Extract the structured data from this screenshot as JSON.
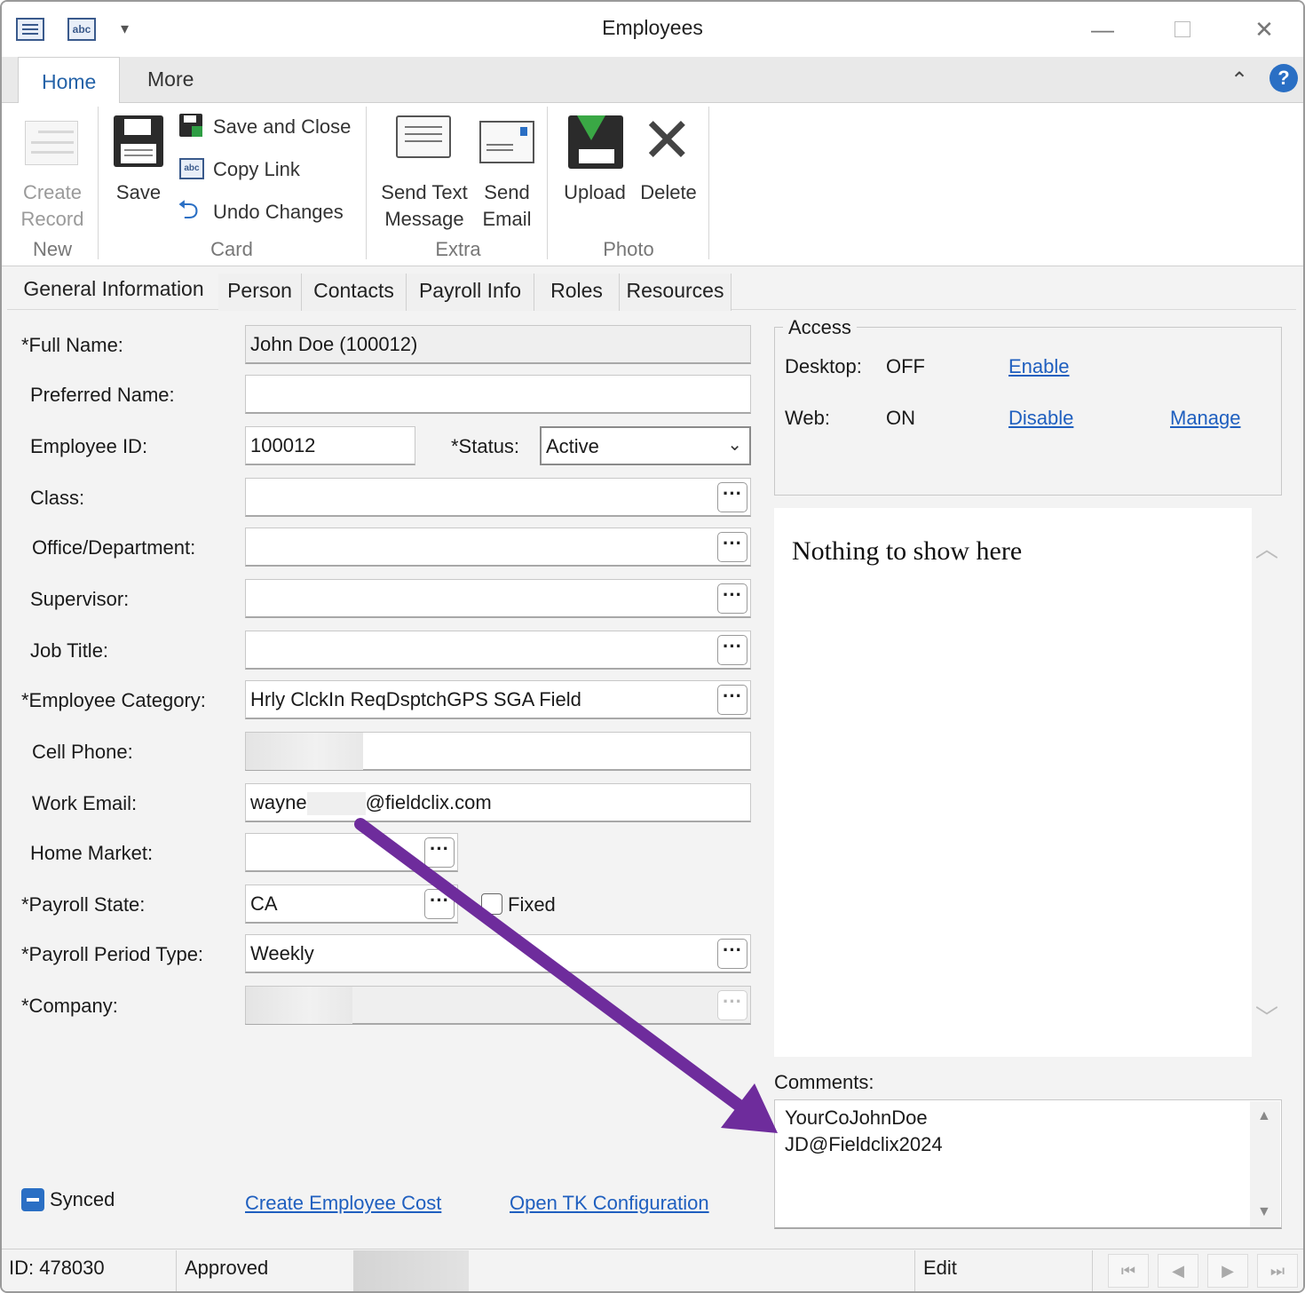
{
  "window": {
    "title": "Employees"
  },
  "ribbon": {
    "tabs": [
      "Home",
      "More"
    ],
    "new_group": {
      "label": "New",
      "create_record": "Create\nRecord"
    },
    "card_group": {
      "label": "Card",
      "save": "Save",
      "save_and_close": "Save and Close",
      "copy_link": "Copy Link",
      "undo_changes": "Undo Changes"
    },
    "extra_group": {
      "label": "Extra",
      "send_text": "Send Text\nMessage",
      "send_email": "Send\nEmail"
    },
    "photo_group": {
      "label": "Photo",
      "upload": "Upload",
      "delete": "Delete"
    }
  },
  "form_tabs": [
    "General Information",
    "Person",
    "Contacts",
    "Payroll Info",
    "Roles",
    "Resources"
  ],
  "form": {
    "full_name": {
      "label": "*Full Name:",
      "value": "John Doe (100012)"
    },
    "preferred_name": {
      "label": "Preferred Name:",
      "value": ""
    },
    "employee_id": {
      "label": "Employee ID:",
      "value": "100012"
    },
    "status": {
      "label": "*Status:",
      "value": "Active"
    },
    "class": {
      "label": "Class:",
      "value": ""
    },
    "office_department": {
      "label": "Office/Department:",
      "value": ""
    },
    "supervisor": {
      "label": "Supervisor:",
      "value": ""
    },
    "job_title": {
      "label": "Job Title:",
      "value": ""
    },
    "employee_category": {
      "label": "*Employee Category:",
      "value": "Hrly ClckIn ReqDsptchGPS SGA Field"
    },
    "cell_phone": {
      "label": "Cell Phone:",
      "value": ""
    },
    "work_email": {
      "label": "Work Email:",
      "value_prefix": "wayne",
      "value_suffix": "@fieldclix.com"
    },
    "home_market": {
      "label": "Home Market:",
      "value": ""
    },
    "payroll_state": {
      "label": "*Payroll State:",
      "value": "CA",
      "fixed_label": "Fixed",
      "fixed_checked": false
    },
    "payroll_period_type": {
      "label": "*Payroll Period Type:",
      "value": "Weekly"
    },
    "company": {
      "label": "*Company:",
      "value": ""
    }
  },
  "access": {
    "title": "Access",
    "desktop": {
      "label": "Desktop:",
      "state": "OFF",
      "action": "Enable"
    },
    "web": {
      "label": "Web:",
      "state": "ON",
      "action": "Disable",
      "manage": "Manage"
    }
  },
  "photo_panel": {
    "empty_text": "Nothing to show here"
  },
  "comments": {
    "label": "Comments:",
    "lines": [
      "YourCoJohnDoe",
      "JD@Fieldclix2024"
    ]
  },
  "bottom": {
    "synced_label": "Synced",
    "create_employee_cost": "Create Employee Cost",
    "open_tk_configuration": "Open TK Configuration"
  },
  "status_bar": {
    "id": "ID: 478030",
    "approval": "Approved",
    "mode": "Edit"
  },
  "colors": {
    "accent": "#2563a8",
    "link": "#1f5fbf",
    "annotation_arrow": "#6e2c9c"
  },
  "icons": [
    "form-icon",
    "abc-icon",
    "dropdown-icon",
    "minimize-icon",
    "maximize-icon",
    "close-icon",
    "collapse-ribbon-icon",
    "help-icon",
    "create-record-icon",
    "save-icon",
    "save-close-icon",
    "copy-link-icon",
    "undo-icon",
    "send-text-icon",
    "send-email-icon",
    "upload-icon",
    "delete-icon",
    "ellipsis-icon",
    "chevron-up-icon",
    "chevron-down-icon",
    "first-record-icon",
    "prev-record-icon",
    "next-record-icon",
    "last-record-icon"
  ]
}
